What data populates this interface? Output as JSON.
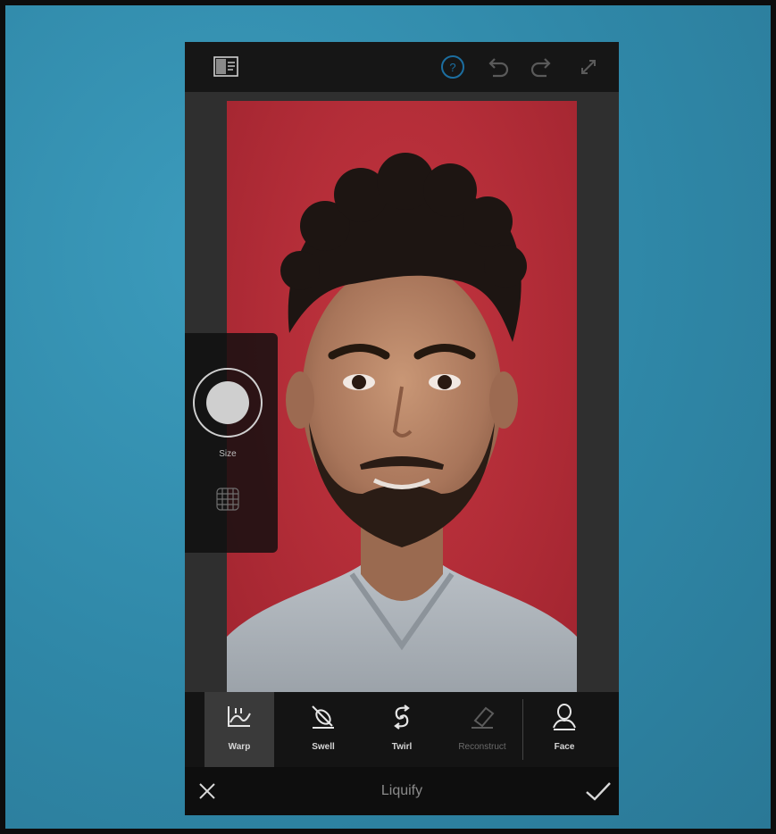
{
  "app": {
    "title": "Liquify"
  },
  "topbar": {
    "icons": [
      "compare-icon",
      "help-icon",
      "undo-icon",
      "redo-icon",
      "expand-icon"
    ],
    "accent_color": "#1c6ea0"
  },
  "side_panel": {
    "size_label": "Size",
    "icons": [
      "brush-size-icon",
      "mesh-grid-icon"
    ]
  },
  "tools": [
    {
      "label": "Warp",
      "icon": "warp-icon",
      "active": true
    },
    {
      "label": "Swell",
      "icon": "swell-icon",
      "active": false
    },
    {
      "label": "Twirl",
      "icon": "twirl-icon",
      "active": false
    },
    {
      "label": "Reconstruct",
      "icon": "reconstruct-icon",
      "active": false,
      "disabled": true
    },
    {
      "label": "Face",
      "icon": "face-icon",
      "active": false
    }
  ],
  "bottombar": {
    "icons": [
      "close-icon",
      "checkmark-icon"
    ]
  },
  "colors": {
    "background": "#2f87a7",
    "photo_background": "#b32d38",
    "toolbar": "#141414"
  }
}
